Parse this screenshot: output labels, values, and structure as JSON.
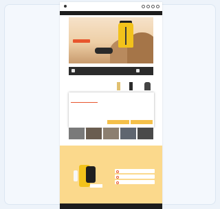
{
  "header": {
    "logo": "",
    "nav": [
      "",
      "",
      "",
      "",
      ""
    ],
    "icons": [
      "search-icon",
      "user-icon",
      "heart-icon",
      "cart-icon"
    ]
  },
  "promo_bar": "",
  "hero": {
    "pretitle": "",
    "headline": "",
    "subtitle": "",
    "cta": ""
  },
  "categories": [
    "",
    "",
    "",
    "",
    ""
  ],
  "section_title": "",
  "cookie_modal": {
    "tabs": [
      "",
      "",
      ""
    ],
    "heading": "",
    "body": "",
    "button_primary": "",
    "button_secondary": ""
  },
  "tiles": [
    "",
    "",
    "",
    "",
    ""
  ],
  "yellow_section": {
    "title": "",
    "bullets": [
      "",
      "",
      ""
    ]
  },
  "footer_text": "",
  "colors": {
    "accent": "#e8552d",
    "yellow": "#f2c21b",
    "dark": "#1c1c1c"
  }
}
